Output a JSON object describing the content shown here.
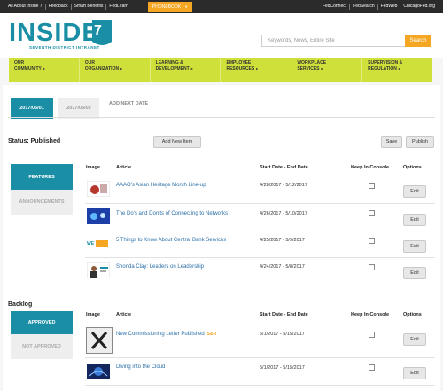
{
  "topbar": {
    "left_links": [
      "All About Inside 7",
      "Feedback",
      "Smart Benefits",
      "FedLearn"
    ],
    "phonebook": "PHONEBOOK",
    "right_links": [
      "FedConnect",
      "FedSearch",
      "FedWeb",
      "ChicagoFed.org"
    ]
  },
  "header": {
    "logo_word": "INSIDE",
    "logo_digit": "7",
    "logo_sub": "SEVENTH DISTRICT INTRANET",
    "search_placeholder": "Keywords, News, Entire Site",
    "search_button": "Search"
  },
  "nav": [
    {
      "line1": "OUR",
      "line2": "COMMUNITY"
    },
    {
      "line1": "OUR",
      "line2": "ORGANIZATION"
    },
    {
      "line1": "LEARNING &",
      "line2": "DEVELOPMENT"
    },
    {
      "line1": "EMPLOYEE",
      "line2": "RESOURCES"
    },
    {
      "line1": "WORKPLACE",
      "line2": "SERVICES"
    },
    {
      "line1": "SUPERVISION &",
      "line2": "REGULATION"
    }
  ],
  "tabs": {
    "date1": "2017/05/01",
    "date2": "2017/05/02",
    "add_next": "ADD NEXT DATE"
  },
  "status": {
    "label": "Status: Published",
    "add_button": "Add New Item",
    "save_button": "Save",
    "publish_button": "Publish"
  },
  "sidebar1": {
    "features": "FEATURES",
    "announcements": "ANNOUNCEMENTS"
  },
  "sidebar2": {
    "approved": "APPROVED",
    "not_approved": "NOT APPROVED"
  },
  "columns": {
    "image": "Image",
    "article": "Article",
    "dates": "Start Date - End Date",
    "keep": "Keep In Console",
    "options": "Options"
  },
  "features": [
    {
      "title": "AAAO's Asian Heritage Month Line-up",
      "dates": "4/28/2017 - 5/12/2017",
      "edit": "Edit"
    },
    {
      "title": "The Do's and Don'ts of Connecting to Networks",
      "dates": "4/26/2017 - 5/10/2017",
      "edit": "Edit"
    },
    {
      "title": "5 Things to Know About Central Bank Services",
      "dates": "4/25/2017 - 5/9/2017",
      "edit": "Edit"
    },
    {
      "title": "Shonda Clay: Leaders on Leadership",
      "dates": "4/24/2017 - 5/8/2017",
      "edit": "Edit"
    }
  ],
  "thumb_text": "WE",
  "backlog_title": "Backlog",
  "backlog": [
    {
      "title": "New Commissioning Letter Published",
      "badge": "S&R",
      "dates": "5/1/2017 - 5/15/2017",
      "edit": "Edit"
    },
    {
      "title": "Diving into the Cloud",
      "dates": "5/1/2017 - 5/15/2017",
      "edit": "Edit"
    }
  ],
  "colors": {
    "teal": "#1a8ea4",
    "lime": "#cfe03a",
    "orange": "#f5a623",
    "dark": "#2b2b2b"
  }
}
